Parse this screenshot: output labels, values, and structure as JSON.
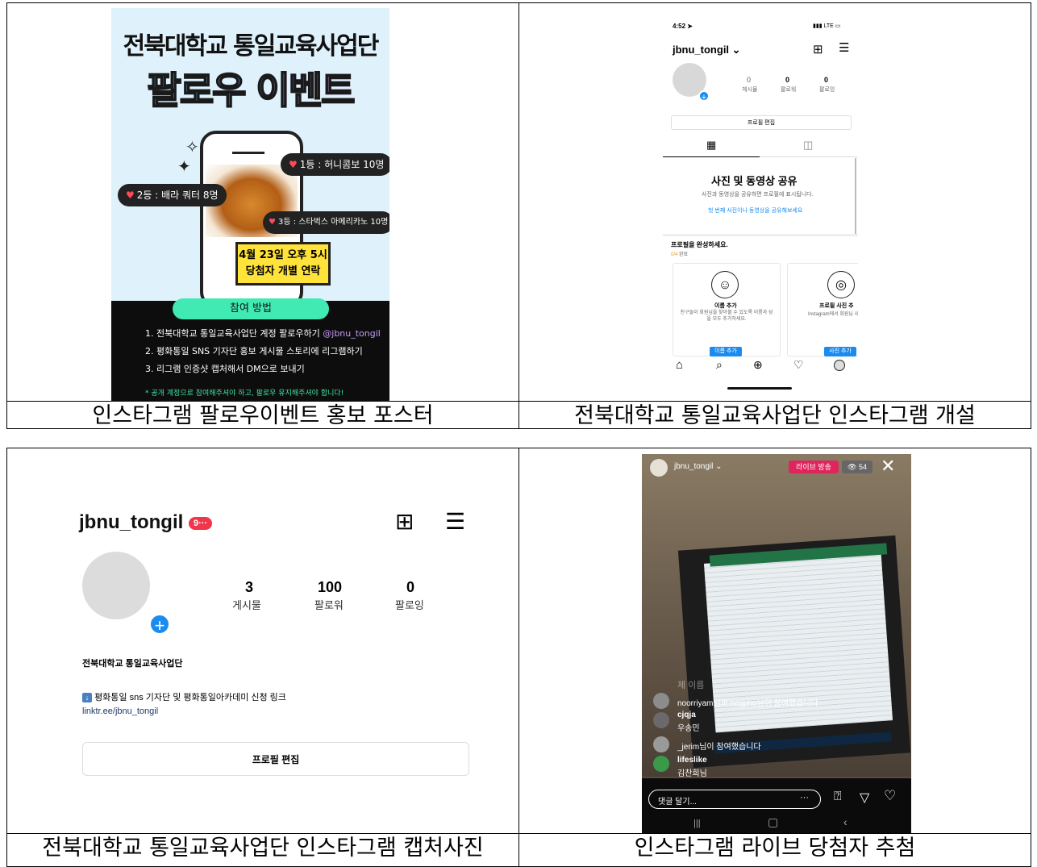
{
  "poster": {
    "title1": "전북대학교 통일교육사업단",
    "title2": "팔로우 이벤트",
    "prize1": "1등 : 허니콤보 10명",
    "prize2": "2등 : 배라 쿼터 8명",
    "prize3": "3등 : 스타벅스 아메리카노 10명",
    "date_line1": "4월 23일 오후 5시",
    "date_line2": "당첨자 개별 연락",
    "how_label": "참여 방법",
    "step1": "1. 전북대학교 통일교육사업단 계정 팔로우하기",
    "step1_handle": "@jbnu_tongil",
    "step2": "2. 평화통일 SNS 기자단 홍보 게시물 스토리에 리그램하기",
    "step3": "3. 리그램 인증샷 캡처해서 DM으로 보내기",
    "note": "* 공개 계정으로 참여해주셔야 하고, 팔로우 유지해주셔야 합니다!"
  },
  "ig_new": {
    "time": "4:52",
    "signal": "LTE",
    "username": "jbnu_tongil",
    "posts_count": "0",
    "posts_label": "게시물",
    "followers_count": "0",
    "followers_label": "팔로워",
    "following_count": "0",
    "following_label": "팔로잉",
    "edit_profile": "프로필 편집",
    "share_title": "사진 및 동영상 공유",
    "share_desc": "사진과 동영상을 공유하면 프로필에 표시됩니다.",
    "share_link": "첫 번째 사진이나 동영상을 공유해보세요",
    "complete_title": "프로필을 완성하세요.",
    "complete_progress": "0/4",
    "complete_done": "완료",
    "card1_title": "이름 추가",
    "card1_desc": "친구들이 회원님을 찾아볼 수 있도록 이름과 성을 모두 추가하세요.",
    "card1_button": "이름 추가",
    "card2_title": "프로필 사진 추",
    "card2_desc": "Instagram에서 회원님 사진을 선택하세",
    "card2_button": "사진 추가"
  },
  "ig_profile": {
    "username": "jbnu_tongil",
    "badge": "9···",
    "posts_count": "3",
    "posts_label": "게시물",
    "followers_count": "100",
    "followers_label": "팔로워",
    "following_count": "0",
    "following_label": "팔로잉",
    "bio_name": "전북대학교 통일교육사업단",
    "bio_line": "평화통일 sns 기자단 및 평화통일아카데미 신청 링크",
    "bio_link": "linktr.ee/jbnu_tongil",
    "edit_profile": "프로필 편집"
  },
  "live": {
    "username": "jbnu_tongil",
    "live_badge": "라이브 방송",
    "viewers": "54",
    "faded": "제 이름",
    "c1": "noorriyam님과 ncgpho님이 참여했습니다",
    "c2_user": "cjqja",
    "c2_text": "우송민",
    "c3": "_jerim님이 참여했습니다",
    "c4_user": "lifeslike",
    "c4_text": "김찬희님",
    "comment_placeholder": "댓글 달기...",
    "more": "···"
  },
  "captions": {
    "c1": "인스타그램 팔로우이벤트 홍보 포스터",
    "c2": "전북대학교 통일교육사업단 인스타그램 개설",
    "c3": "전북대학교 통일교육사업단 인스타그램 캡처사진",
    "c4": "인스타그램 라이브 당첨자 추첨"
  }
}
